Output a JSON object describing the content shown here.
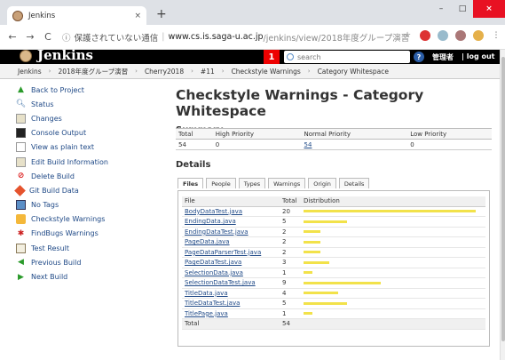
{
  "browser": {
    "tab_title": "Jenkins",
    "tab_close": "×",
    "new_tab": "+",
    "minimize": "–",
    "maximize": "□",
    "close": "×",
    "back": "←",
    "forward": "→",
    "reload": "C",
    "info_icon": "ⓘ",
    "insecure_label": "保護されていない通信",
    "separator": "|",
    "url_host": "www.cs.is.saga-u.ac.jp",
    "url_path": "/jenkins/view/2018年度グループ演習/job/Cherry···",
    "star": "☆",
    "menu": "⋮"
  },
  "header": {
    "logo": "Jenkins",
    "notification_count": "1",
    "search_placeholder": "search",
    "help": "?",
    "user": "管理者",
    "logout": "| log out"
  },
  "breadcrumbs": [
    "Jenkins",
    "2018年度グループ演習",
    "Cherry2018",
    "#11",
    "Checkstyle Warnings",
    "Category Whitespace"
  ],
  "crumb_sep": "›",
  "sidebar": [
    {
      "label": "Back to Project",
      "icon": "arrow-up-icon"
    },
    {
      "label": "Status",
      "icon": "magnifier-icon"
    },
    {
      "label": "Changes",
      "icon": "notepad-icon"
    },
    {
      "label": "Console Output",
      "icon": "terminal-icon"
    },
    {
      "label": "View as plain text",
      "icon": "document-icon"
    },
    {
      "label": "Edit Build Information",
      "icon": "notepad-icon"
    },
    {
      "label": "Delete Build",
      "icon": "no-entry-icon"
    },
    {
      "label": "Git Build Data",
      "icon": "git-icon"
    },
    {
      "label": "No Tags",
      "icon": "monitor-icon"
    },
    {
      "label": "Checkstyle Warnings",
      "icon": "checkstyle-icon"
    },
    {
      "label": "FindBugs Warnings",
      "icon": "bug-icon"
    },
    {
      "label": "Test Result",
      "icon": "clipboard-icon"
    },
    {
      "label": "Previous Build",
      "icon": "arrow-left-icon"
    },
    {
      "label": "Next Build",
      "icon": "arrow-right-icon"
    }
  ],
  "main": {
    "title": "Checkstyle Warnings - Category Whitespace",
    "summary_heading": "Summary",
    "summary_headers": [
      "Total",
      "High Priority",
      "Normal Priority",
      "Low Priority"
    ],
    "summary_values": [
      "54",
      "0",
      "54",
      "0"
    ],
    "details_heading": "Details",
    "tabs": [
      "Files",
      "People",
      "Types",
      "Warnings",
      "Origin",
      "Details"
    ],
    "files_headers": [
      "File",
      "Total",
      "Distribution"
    ],
    "files": [
      {
        "name": "BodyDataTest.java",
        "total": "20",
        "count": 20
      },
      {
        "name": "EndingData.java",
        "total": "5",
        "count": 5
      },
      {
        "name": "EndingDataTest.java",
        "total": "2",
        "count": 2
      },
      {
        "name": "PageData.java",
        "total": "2",
        "count": 2
      },
      {
        "name": "PageDataParserTest.java",
        "total": "2",
        "count": 2
      },
      {
        "name": "PageDataTest.java",
        "total": "3",
        "count": 3
      },
      {
        "name": "SelectionData.java",
        "total": "1",
        "count": 1
      },
      {
        "name": "SelectionDataTest.java",
        "total": "9",
        "count": 9
      },
      {
        "name": "TitleData.java",
        "total": "4",
        "count": 4
      },
      {
        "name": "TitleDataTest.java",
        "total": "5",
        "count": 5
      },
      {
        "name": "TitlePage.java",
        "total": "1",
        "count": 1
      }
    ],
    "files_total_label": "Total",
    "files_total": "54",
    "bar_color": "#f2e24a"
  }
}
